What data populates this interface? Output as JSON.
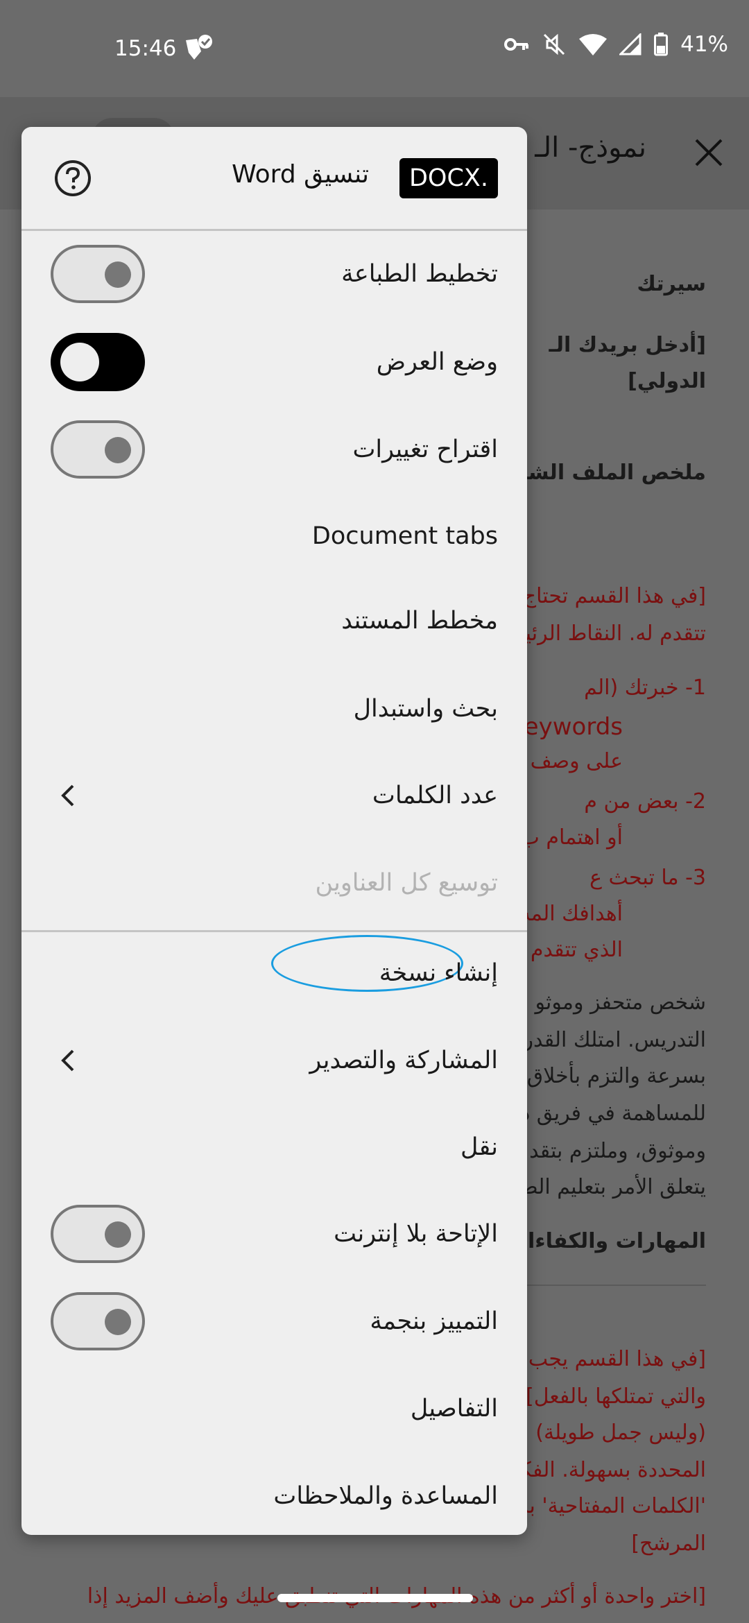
{
  "status_bar": {
    "time": "15:46",
    "battery": "41%",
    "icons": [
      "vpn-key-icon",
      "mute-icon",
      "wifi-icon",
      "signal-icon",
      "battery-icon",
      "notification-icon"
    ]
  },
  "document": {
    "title": "نموذج- الـ",
    "lines": [
      {
        "text": "سيرتك",
        "style": "bold"
      },
      {
        "text": "[أدخل بريدك الـ",
        "style": "bold"
      },
      {
        "text": "الدولي]",
        "style": "bold"
      },
      {
        "text": "ملخص الملف الشخص",
        "style": "bold"
      },
      {
        "text": "[في هذا القسم تحتاج",
        "style": "red"
      },
      {
        "text": "تتقدم له. النقاط الرئيس",
        "style": "red"
      },
      {
        "text": "1-  خبرتك (الم",
        "style": "red"
      },
      {
        "text": "eywords",
        "style": "red"
      },
      {
        "text": "على وصف",
        "style": "red"
      },
      {
        "text": "2-  بعض من م",
        "style": "red"
      },
      {
        "text": "أو اهتمام ب",
        "style": "red"
      },
      {
        "text": "3-  ما تبحث ع",
        "style": "red"
      },
      {
        "text": "أهدافك المه",
        "style": "red"
      },
      {
        "text": "الذي تتقدم ا",
        "style": "red"
      },
      {
        "text": "شخص متحفز وموثو",
        "style": "plain"
      },
      {
        "text": "التدريس. امتلك القدر",
        "style": "plain"
      },
      {
        "text": "بسرعة والتزم بأخلاق",
        "style": "plain"
      },
      {
        "text": "للمساهمة في فريق دي",
        "style": "plain"
      },
      {
        "text": "وموثوق، وملتزم بتقد",
        "style": "plain"
      },
      {
        "text": "يتعلق الأمر بتعليم الط",
        "style": "plain"
      },
      {
        "text": "المهارات والكفاءات",
        "style": "bold"
      },
      {
        "text": "[في هذا القسم يجب أ",
        "style": "red"
      },
      {
        "text": "والتي تمتلكها بالفعل]",
        "style": "red"
      },
      {
        "text": "(وليس جمل طويلة)",
        "style": "red"
      },
      {
        "text": "المحددة بسهولة. الفكر",
        "style": "red"
      },
      {
        "text": "'الكلمات المفتاحية' بس",
        "style": "red"
      },
      {
        "text": "المرشح]",
        "style": "red"
      },
      {
        "text": "[اختر واحدة أو أكثر من هذه المهارات التي تنطبق عليك وأضف المزيد إذا",
        "style": "red"
      }
    ]
  },
  "menu": {
    "header": {
      "badge": "DOCX.",
      "format_label": "تنسيق Word",
      "help_icon": "help-icon"
    },
    "items": [
      {
        "label": "تخطيط الطباعة",
        "toggle": "off"
      },
      {
        "label": "وضع العرض",
        "toggle": "on"
      },
      {
        "label": "اقتراح تغييرات",
        "toggle": "off"
      },
      {
        "label": "Document tabs"
      },
      {
        "label": "مخطط المستند"
      },
      {
        "label": "بحث واستبدال"
      },
      {
        "label": "عدد الكلمات",
        "chevron": true
      },
      {
        "label": "توسيع كل العناوين",
        "disabled": true
      },
      {
        "label": "إنشاء نسخة",
        "highlighted": true
      },
      {
        "label": "المشاركة والتصدير",
        "chevron": true
      },
      {
        "label": "نقل"
      },
      {
        "label": "الإتاحة بلا إنترنت",
        "toggle": "off"
      },
      {
        "label": "التمييز بنجمة",
        "toggle": "off"
      },
      {
        "label": "التفاصيل"
      },
      {
        "label": "المساعدة والملاحظات"
      }
    ]
  },
  "colors": {
    "accent_highlight": "#1a9de0",
    "menu_background": "#efefef",
    "scrim": "#6b6b6b",
    "doc_red_text": "#7a1010"
  }
}
